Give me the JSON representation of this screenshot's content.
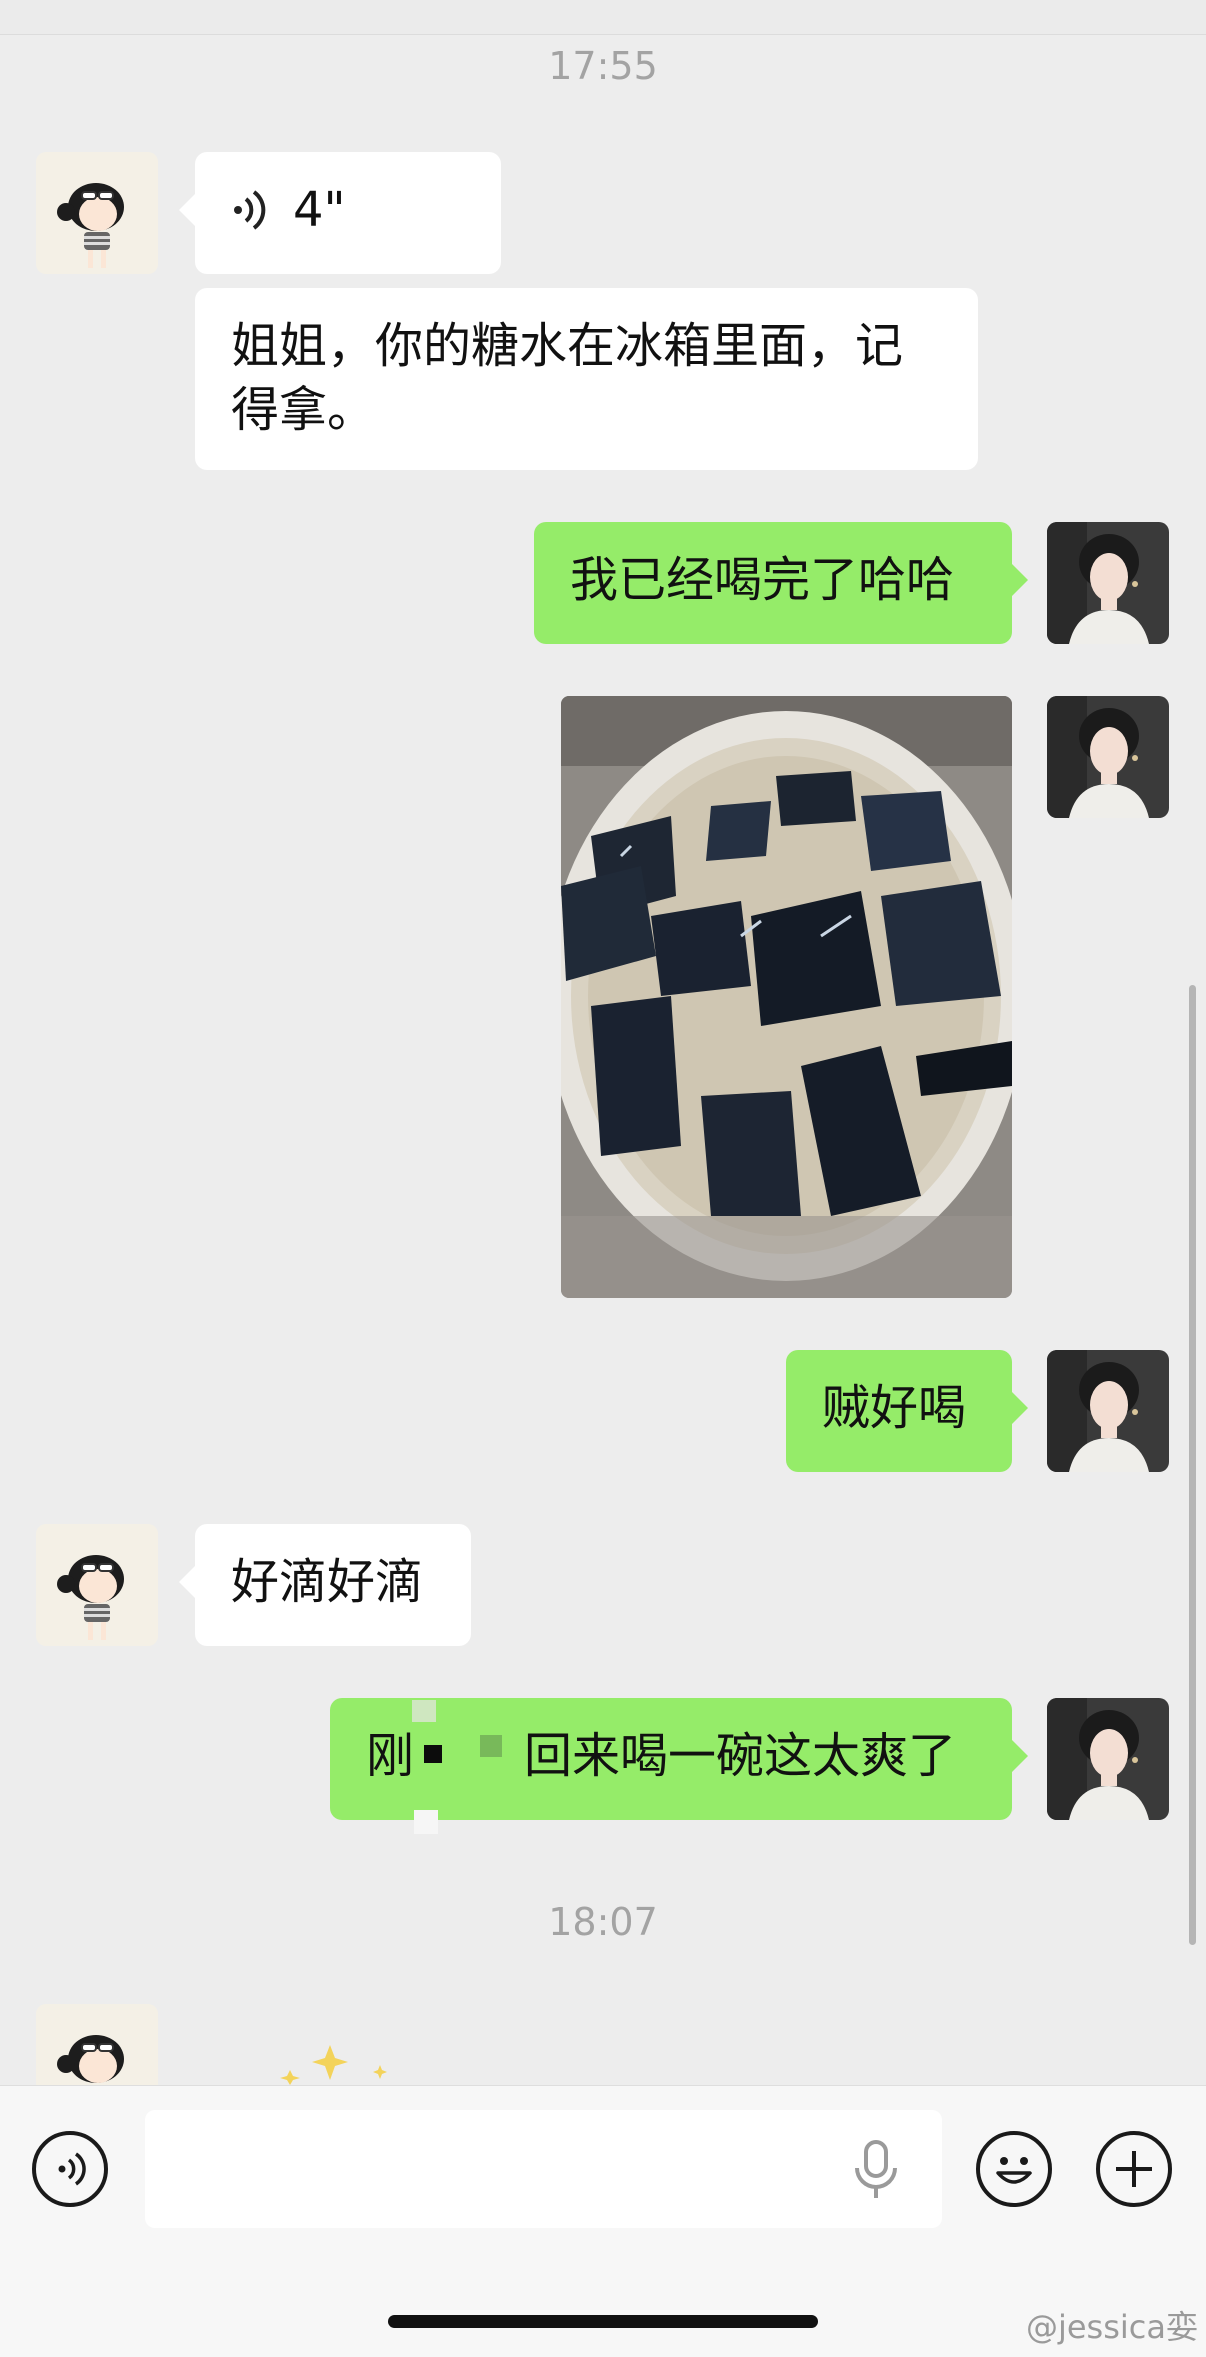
{
  "chat": {
    "timestamp_1": "17:55",
    "voice_duration": "4\"",
    "msg_in_1": "姐姐，你的糖水在冰箱里面，记得拿。",
    "msg_out_1": "我已经喝完了哈哈",
    "msg_out_2": "贼好喝",
    "msg_in_2": "好滴好滴",
    "msg_out_3_start": "刚",
    "msg_out_3_end": "回来喝一碗这太爽了",
    "timestamp_2": "18:07"
  },
  "watermark": "@jessica娈",
  "icons": [
    "voice-wave-icon",
    "microphone-icon",
    "emoji-icon",
    "plus-icon",
    "keyboard-voice-toggle-icon"
  ],
  "colors": {
    "background": "#ededed",
    "bubble_outgoing": "#95ec69",
    "bubble_incoming": "#ffffff",
    "input_bar": "#f7f7f7"
  }
}
